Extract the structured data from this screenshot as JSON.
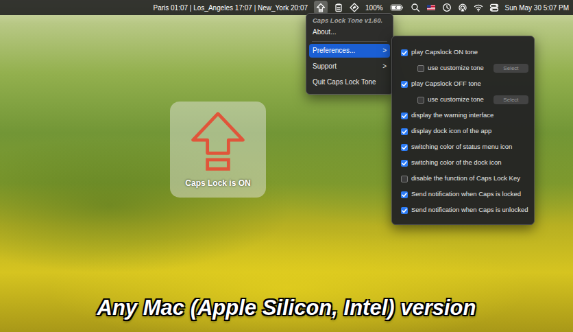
{
  "menubar": {
    "clocks": "Paris 01:07 | Los_Angeles 17:07 | New_York 20:07",
    "battery": "100%",
    "datetime": "Sun May 30 5:07 PM"
  },
  "app_menu": {
    "title": "Caps Lock Tone v1.60.",
    "items": [
      {
        "label": "About...",
        "kind": "action",
        "selected": false
      },
      {
        "label": "Preferences...",
        "kind": "submenu",
        "arrow": ">",
        "selected": true
      },
      {
        "label": "Support",
        "kind": "submenu",
        "arrow": ">",
        "selected": false
      },
      {
        "label": "Quit Caps Lock Tone",
        "kind": "action",
        "selected": false
      }
    ]
  },
  "preferences": [
    {
      "kind": "check",
      "label": "play Capslock ON tone",
      "checked": true
    },
    {
      "kind": "custom",
      "label": "use customize tone",
      "checked": false,
      "button": "Select",
      "button_disabled": true
    },
    {
      "kind": "check",
      "label": "play Capslock OFF tone",
      "checked": true
    },
    {
      "kind": "custom",
      "label": "use customize tone",
      "checked": false,
      "button": "Select",
      "button_disabled": true
    },
    {
      "kind": "check",
      "label": "display the warning interface",
      "checked": true
    },
    {
      "kind": "check",
      "label": "display dock icon of the app",
      "checked": true
    },
    {
      "kind": "check",
      "label": "switching color of status menu icon",
      "checked": true
    },
    {
      "kind": "check",
      "label": "switching color of the dock icon",
      "checked": true
    },
    {
      "kind": "check",
      "label": "disable the function of Caps Lock Key",
      "checked": false
    },
    {
      "kind": "check",
      "label": "Send notification when Caps is locked",
      "checked": true
    },
    {
      "kind": "check",
      "label": "Send notification when Caps is unlocked",
      "checked": true
    }
  ],
  "hud": {
    "text": "Caps Lock is ON"
  },
  "caption": "Any Mac (Apple Silicon, Intel) version"
}
